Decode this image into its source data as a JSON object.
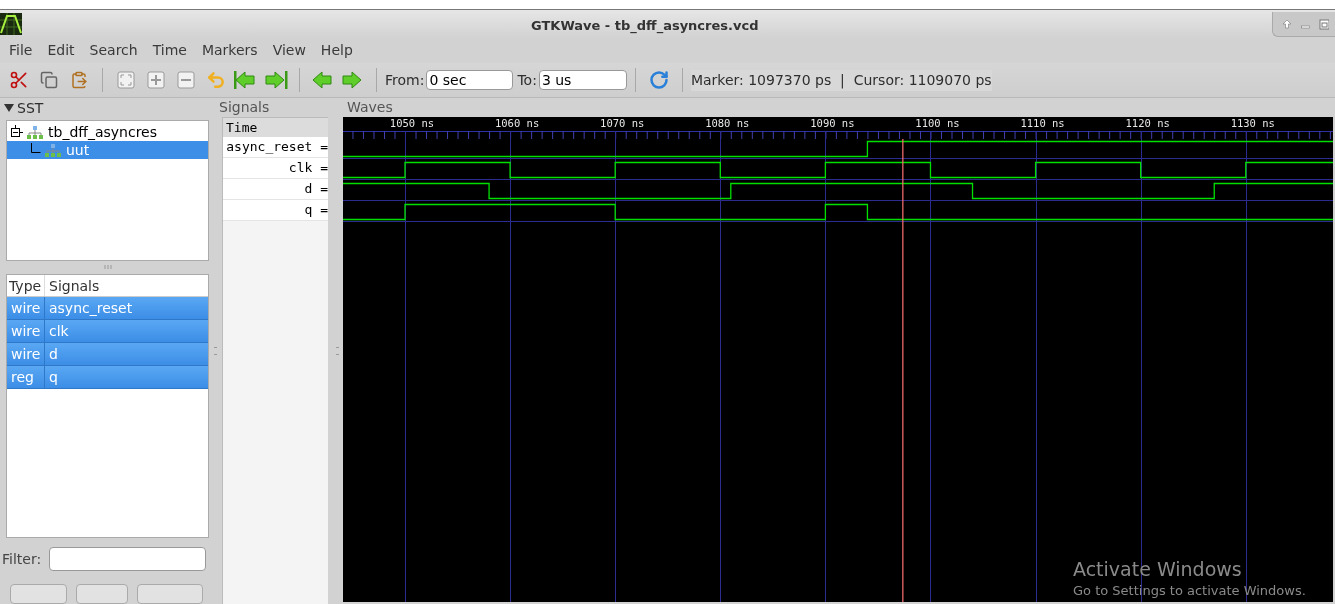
{
  "window": {
    "title": "GTKWave - tb_dff_asyncres.vcd"
  },
  "menu": [
    "File",
    "Edit",
    "Search",
    "Time",
    "Markers",
    "View",
    "Help"
  ],
  "toolbar": {
    "from_label": "From:",
    "from_value": "0 sec",
    "to_label": "To:",
    "to_value": "3 us",
    "status": "Marker: 1097370 ps  |  Cursor: 1109070 ps"
  },
  "sst": {
    "label": "SST",
    "expanded": true,
    "tree": [
      {
        "label": "tb_dff_asyncres",
        "expanded": true,
        "selected": false,
        "children": [
          {
            "label": "uut",
            "selected": true
          }
        ]
      }
    ],
    "table": {
      "columns": [
        "Type",
        "Signals"
      ],
      "rows": [
        {
          "type": "wire",
          "name": "async_reset",
          "selected": true
        },
        {
          "type": "wire",
          "name": "clk",
          "selected": true
        },
        {
          "type": "wire",
          "name": "d",
          "selected": true
        },
        {
          "type": "reg",
          "name": "q",
          "selected": true
        }
      ]
    },
    "filter": {
      "label": "Filter:"
    }
  },
  "signals_panel": {
    "title": "Signals",
    "header": "Time",
    "rows": [
      "async_reset =",
      "clk =",
      "d =",
      "q ="
    ]
  },
  "waves_panel": {
    "title": "Waves",
    "time_labels": [
      "1050 ns",
      "1060 ns",
      "1070 ns",
      "1080 ns",
      "1090 ns",
      "1100 ns",
      "1110 ns",
      "1120 ns",
      "1130 ns"
    ]
  },
  "os_notice": {
    "title": "Activate Windows",
    "subtitle": "Go to Settings to activate Windows."
  }
}
